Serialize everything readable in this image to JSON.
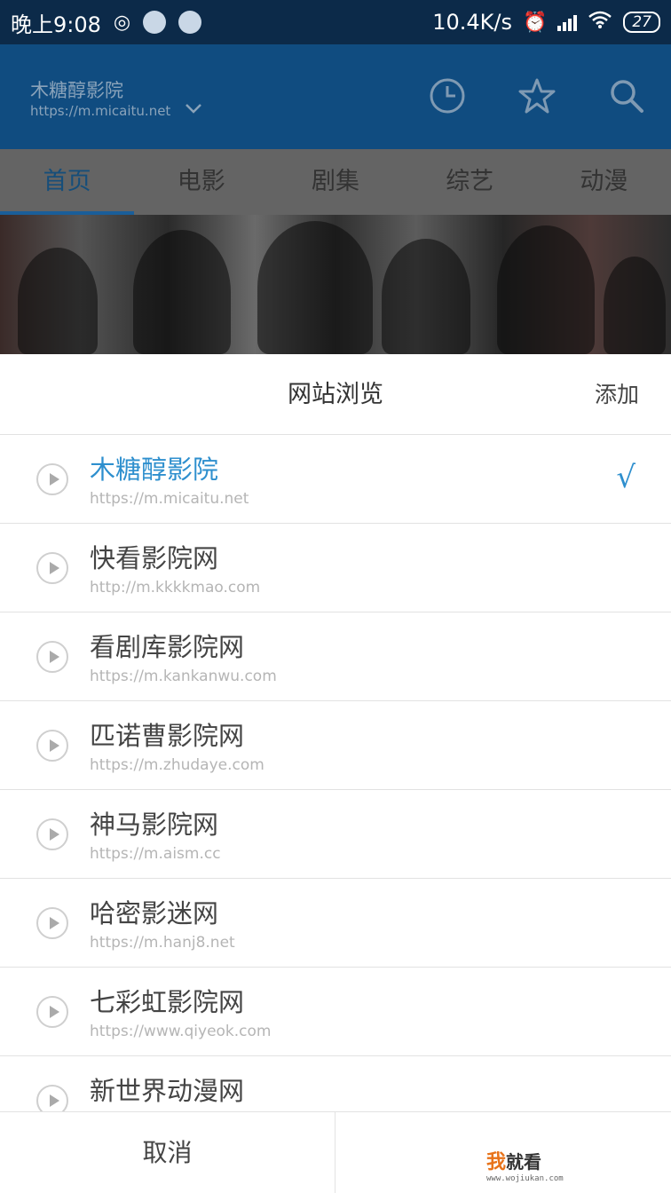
{
  "status_bar": {
    "time": "晚上9:08",
    "net_speed": "10.4K/s",
    "battery": "27"
  },
  "app_bar": {
    "site_title": "木糖醇影院",
    "site_url": "https://m.micaitu.net"
  },
  "tabs": [
    {
      "label": "首页",
      "active": true
    },
    {
      "label": "电影",
      "active": false
    },
    {
      "label": "剧集",
      "active": false
    },
    {
      "label": "综艺",
      "active": false
    },
    {
      "label": "动漫",
      "active": false
    }
  ],
  "sheet": {
    "title": "网站浏览",
    "add_label": "添加",
    "sites": [
      {
        "name": "木糖醇影院",
        "url": "https://m.micaitu.net",
        "selected": true
      },
      {
        "name": "快看影院网",
        "url": "http://m.kkkkmao.com",
        "selected": false
      },
      {
        "name": "看剧库影院网",
        "url": "https://m.kankanwu.com",
        "selected": false
      },
      {
        "name": "匹诺曹影院网",
        "url": "https://m.zhudaye.com",
        "selected": false
      },
      {
        "name": "神马影院网",
        "url": "https://m.aism.cc",
        "selected": false
      },
      {
        "name": "哈密影迷网",
        "url": "https://m.hanj8.net",
        "selected": false
      },
      {
        "name": "七彩虹影院网",
        "url": "https://www.qiyeok.com",
        "selected": false
      },
      {
        "name": "新世界动漫网",
        "url": "",
        "selected": false
      }
    ],
    "check_mark": "√",
    "cancel_label": "取消"
  },
  "watermark": {
    "char1": "我",
    "rest": "就看",
    "url": "www.wojiukan.com"
  },
  "colors": {
    "accent": "#2e8fce",
    "app_bar": "#104c80",
    "status_bar": "#0c2a49"
  }
}
